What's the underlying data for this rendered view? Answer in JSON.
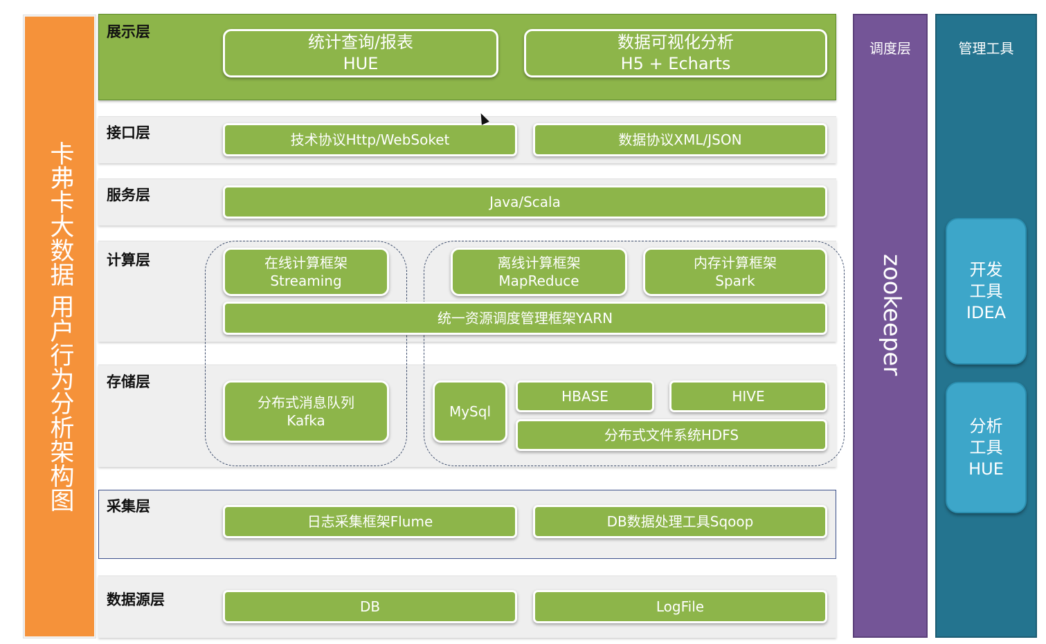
{
  "title_vertical": "卡弗卡大数据 用户行为分析架构图",
  "layers": {
    "display": {
      "label": "展示层",
      "boxes": [
        {
          "line1": "统计查询/报表",
          "line2": "HUE"
        },
        {
          "line1": "数据可视化分析",
          "line2": "H5 + Echarts"
        }
      ]
    },
    "interface": {
      "label": "接口层",
      "boxes": [
        "技术协议Http/WebSoket",
        "数据协议XML/JSON"
      ]
    },
    "service": {
      "label": "服务层",
      "box": "Java/Scala"
    },
    "compute": {
      "label": "计算层",
      "online": {
        "line1": "在线计算框架",
        "line2": "Streaming"
      },
      "offline": {
        "line1": "离线计算框架",
        "line2": "MapReduce"
      },
      "memory": {
        "line1": "内存计算框架",
        "line2": "Spark"
      },
      "yarn": "统一资源调度管理框架YARN"
    },
    "storage": {
      "label": "存储层",
      "kafka": {
        "line1": "分布式消息队列",
        "line2": "Kafka"
      },
      "mysql": "MySql",
      "hbase": "HBASE",
      "hive": "HIVE",
      "hdfs": "分布式文件系统HDFS"
    },
    "collect": {
      "label": "采集层",
      "boxes": [
        "日志采集框架Flume",
        "DB数据处理工具Sqoop"
      ]
    },
    "source": {
      "label": "数据源层",
      "boxes": [
        "DB",
        "LogFile"
      ]
    }
  },
  "scheduler": {
    "title": "调度层",
    "name": "zookeeper"
  },
  "management": {
    "title": "管理工具",
    "tools": [
      {
        "line1": "开发",
        "line2": "工具",
        "line3": "IDEA"
      },
      {
        "line1": "分析",
        "line2": "工具",
        "line3": "HUE"
      }
    ]
  },
  "colors": {
    "title_bg": "#F5923A",
    "green": "#8DB54A",
    "scheduler_bg": "#745597",
    "management_bg": "#24748F",
    "tool_box": "#3DA6C9"
  }
}
